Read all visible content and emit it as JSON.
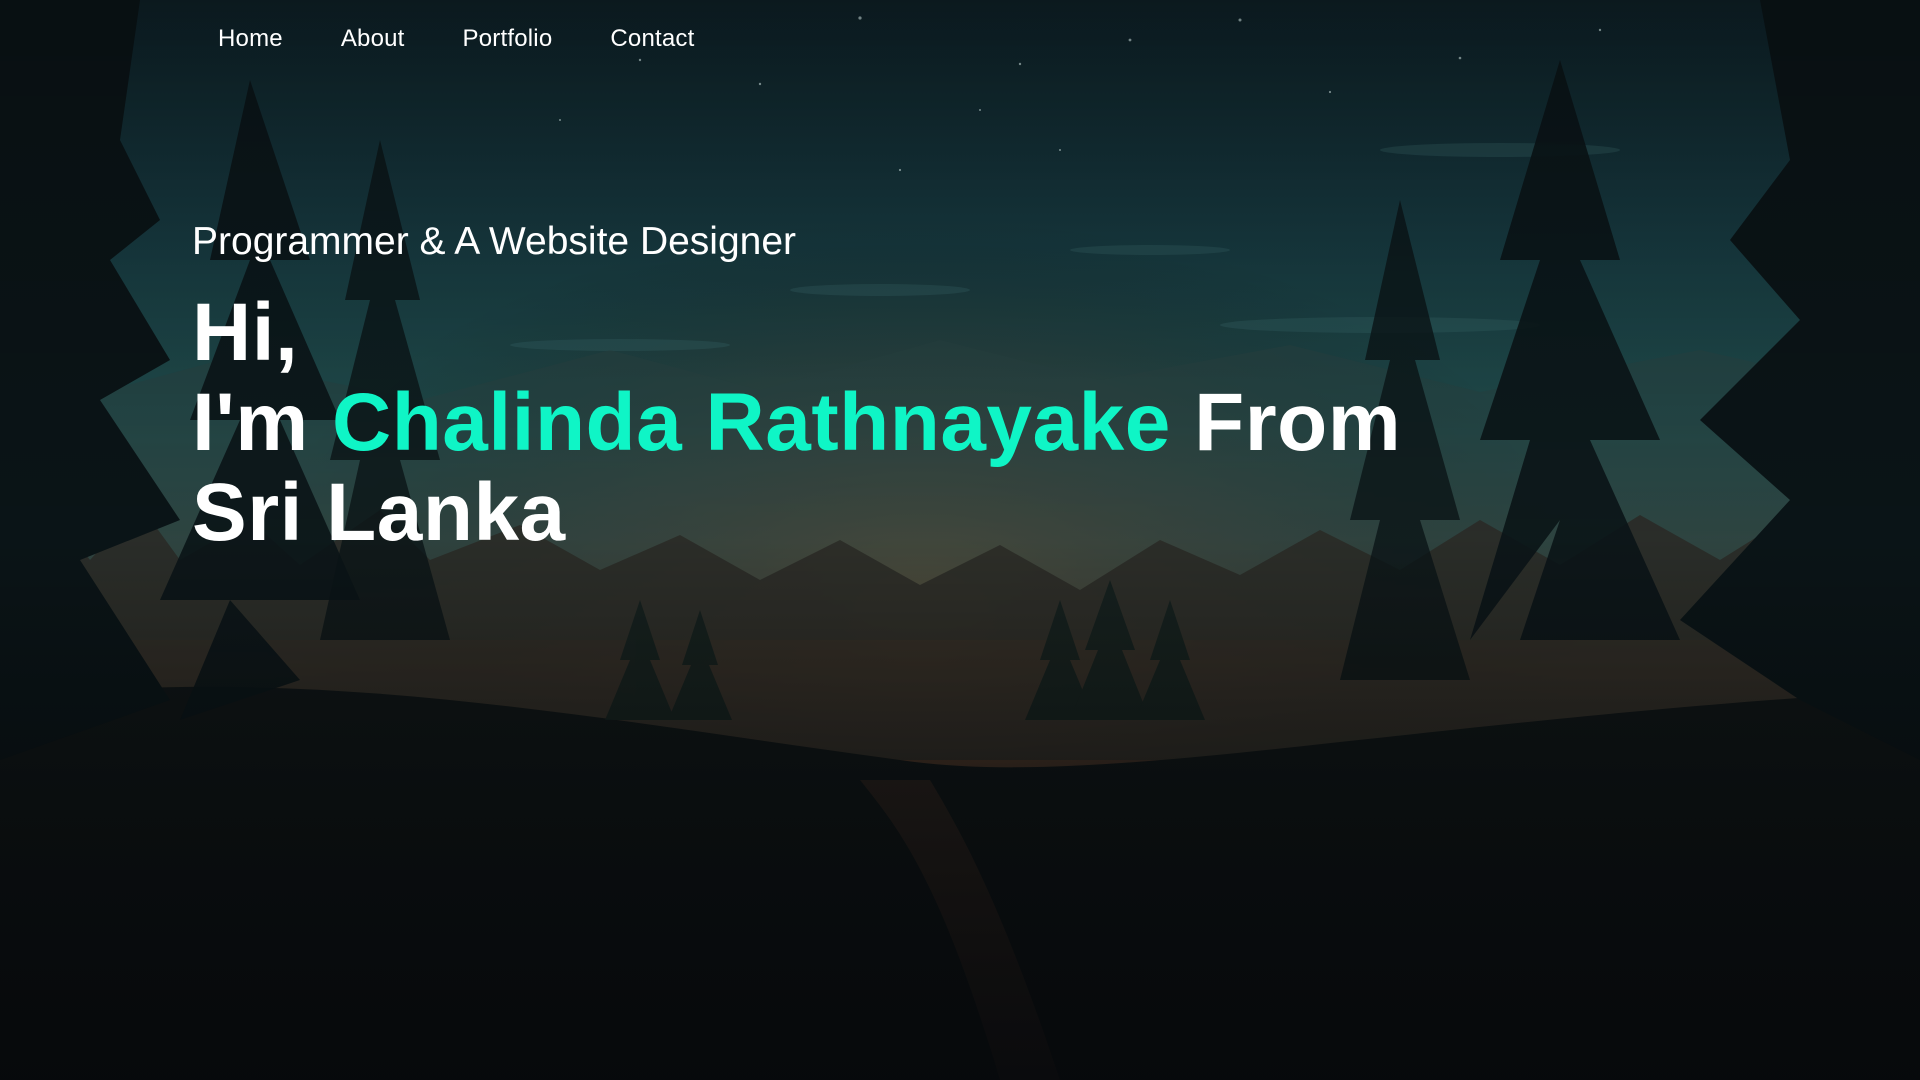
{
  "nav": {
    "items": [
      {
        "label": "Home"
      },
      {
        "label": "About"
      },
      {
        "label": "Portfolio"
      },
      {
        "label": "Contact"
      }
    ]
  },
  "hero": {
    "tagline": "Programmer & A Website Designer",
    "line1": "Hi,",
    "prefix": "I'm ",
    "name": "Chalinda Rathnayake",
    "suffix": " From",
    "line3": "Sri Lanka"
  },
  "colors": {
    "accent": "#0ff5c6",
    "text": "#ffffff",
    "sky_top": "#0f2730",
    "sky_mid": "#1b4a4f",
    "horizon_glow": "#7a4a2a",
    "ground": "#0b0d10"
  },
  "background": {
    "scene": "forest-landscape-night"
  }
}
